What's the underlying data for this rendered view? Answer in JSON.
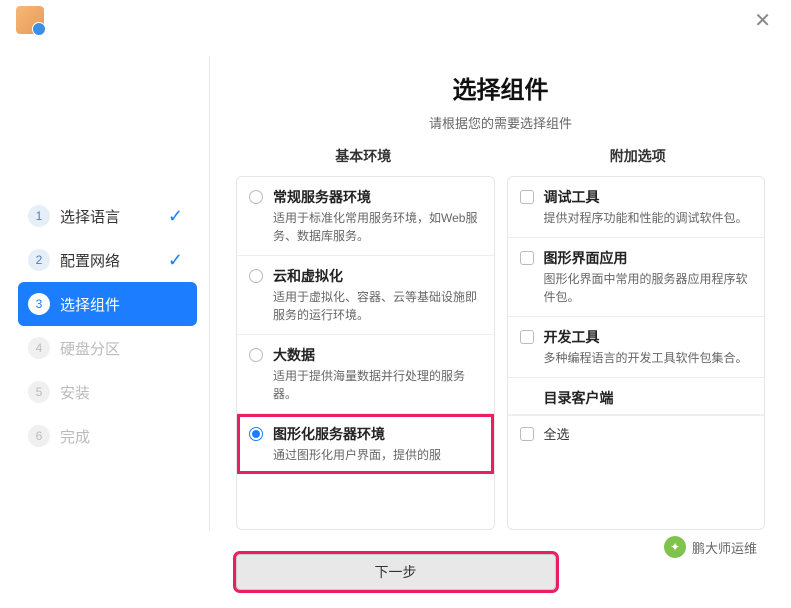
{
  "sidebar": {
    "steps": [
      {
        "num": "1",
        "label": "选择语言",
        "state": "done"
      },
      {
        "num": "2",
        "label": "配置网络",
        "state": "done"
      },
      {
        "num": "3",
        "label": "选择组件",
        "state": "active"
      },
      {
        "num": "4",
        "label": "硬盘分区",
        "state": "pending"
      },
      {
        "num": "5",
        "label": "安装",
        "state": "pending"
      },
      {
        "num": "6",
        "label": "完成",
        "state": "pending"
      }
    ]
  },
  "header": {
    "title": "选择组件",
    "subtitle": "请根据您的需要选择组件"
  },
  "columns": {
    "left_label": "基本环境",
    "right_label": "附加选项"
  },
  "basic_env": [
    {
      "title": "常规服务器环境",
      "desc": "适用于标准化常用服务环境，如Web服务、数据库服务。",
      "selected": false
    },
    {
      "title": "云和虚拟化",
      "desc": "适用于虚拟化、容器、云等基础设施即服务的运行环境。",
      "selected": false
    },
    {
      "title": "大数据",
      "desc": "适用于提供海量数据并行处理的服务器。",
      "selected": false
    },
    {
      "title": "图形化服务器环境",
      "desc": "通过图形化用户界面，提供的服",
      "selected": true
    }
  ],
  "addons": [
    {
      "title": "调试工具",
      "desc": "提供对程序功能和性能的调试软件包。"
    },
    {
      "title": "图形界面应用",
      "desc": "图形化界面中常用的服务器应用程序软件包。"
    },
    {
      "title": "开发工具",
      "desc": "多种编程语言的开发工具软件包集合。"
    },
    {
      "title": "目录客户端",
      "desc": ""
    }
  ],
  "select_all": "全选",
  "next": "下一步",
  "watermark": "鹏大师运维"
}
